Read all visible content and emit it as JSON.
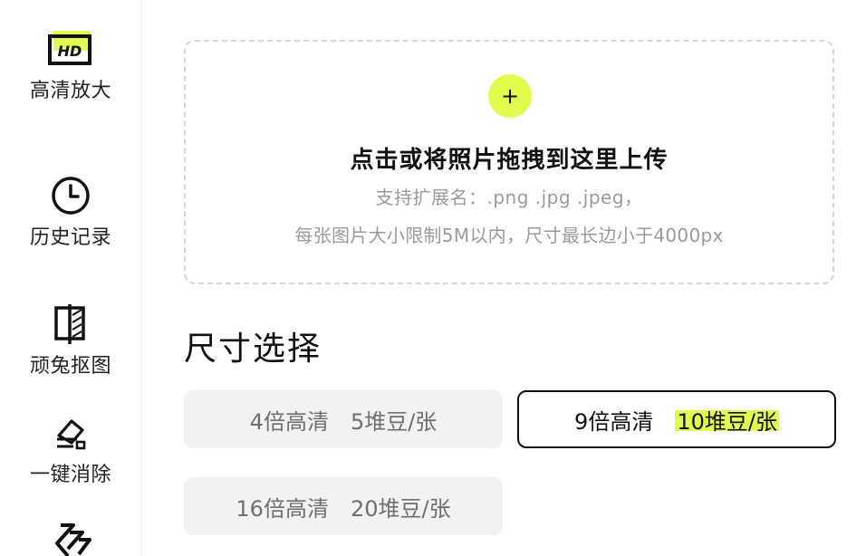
{
  "sidebar": {
    "items": [
      {
        "label": "高清放大",
        "icon": "hd-icon",
        "icon_text": "HD"
      },
      {
        "label": "历史记录",
        "icon": "clock-icon"
      },
      {
        "label": "顽兔抠图",
        "icon": "cutout-icon"
      },
      {
        "label": "一键消除",
        "icon": "eraser-icon"
      },
      {
        "label": "",
        "icon": "layers-icon"
      }
    ]
  },
  "upload": {
    "plus": "+",
    "title": "点击或将照片拖拽到这里上传",
    "hint_formats": "支持扩展名：.png .jpg .jpeg，",
    "hint_limits": "每张图片大小限制5M以内，尺寸最长边小于4000px"
  },
  "size_select": {
    "title": "尺寸选择",
    "options": [
      {
        "name": "4倍高清",
        "price": "5堆豆/张",
        "selected": false
      },
      {
        "name": "9倍高清",
        "price": "10堆豆/张",
        "selected": true
      },
      {
        "name": "16倍高清",
        "price": "20堆豆/张",
        "selected": false
      }
    ]
  },
  "colors": {
    "accent": "#e3fb4f",
    "text": "#111111",
    "muted": "#9a9a9a",
    "option_bg": "#f2f2f3"
  }
}
